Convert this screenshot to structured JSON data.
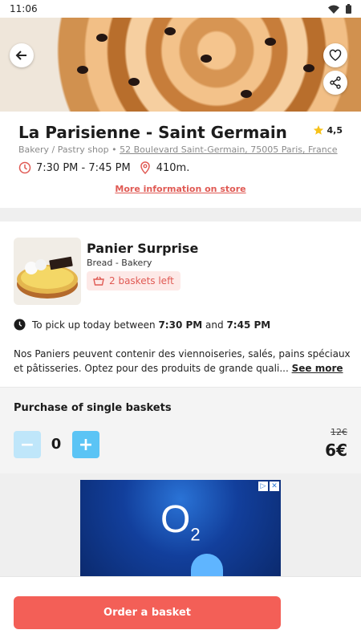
{
  "status_bar": {
    "time": "11:06"
  },
  "store": {
    "name": "La Parisienne - Saint Germain",
    "rating": "4,5",
    "category": "Bakery / Pastry shop",
    "separator": "•",
    "address": "52 Boulevard Saint-Germain, 75005 Paris, France",
    "hours": "7:30 PM - 7:45 PM",
    "distance": "410m.",
    "more_info": "More information on store"
  },
  "basket": {
    "title": "Panier Surprise",
    "category": "Bread - Bakery",
    "left": "2 baskets left",
    "pickup_prefix": "To pick up today between",
    "pickup_start": "7:30 PM",
    "pickup_and": "and",
    "pickup_end": "7:45 PM",
    "description": "Nos Paniers peuvent contenir des viennoiseries, salés, pains spéciaux et pâtisseries. Optez pour des produits de grande quali...",
    "see_more": "See more"
  },
  "purchase": {
    "title": "Purchase of single baskets",
    "minus": "−",
    "plus": "+",
    "quantity": "0",
    "old_price": "12€",
    "price": "6€"
  },
  "ad": {
    "brand": "O",
    "brand_sub": "2"
  },
  "order_button": "Order a basket",
  "colors": {
    "accent": "#f35f57",
    "qty_button": "#5bc4f5",
    "qty_button_disabled": "#bfe6fa",
    "rating_star": "#f7c21a"
  }
}
